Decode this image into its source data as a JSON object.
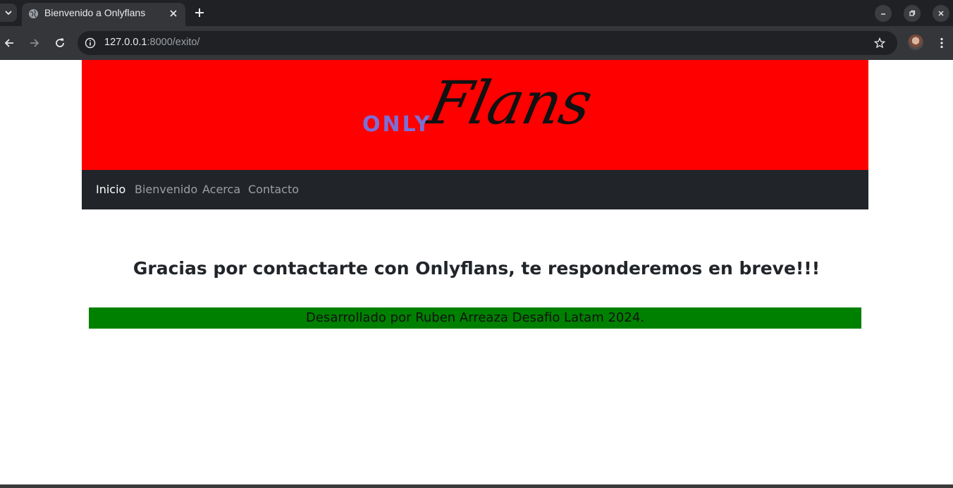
{
  "browser": {
    "tab_title": "Bienvenido a Onlyflans",
    "url_host": "127.0.0.1",
    "url_rest": ":8000/exito/"
  },
  "icons": {
    "tab_list": "chevron-down-icon",
    "favicon": "globe-icon",
    "tab_close": "close-icon",
    "new_tab": "plus-icon",
    "minimize": "minimize-icon",
    "restore": "restore-icon",
    "close_window": "close-icon",
    "back": "arrow-left-icon",
    "forward": "arrow-right-icon",
    "reload": "reload-icon",
    "site_info": "info-icon",
    "bookmark": "star-icon",
    "menu": "kebab-menu-icon"
  },
  "header": {
    "logo_only": "ONLY",
    "logo_flans": "Flans"
  },
  "nav": {
    "items": [
      {
        "label": "Inicio",
        "active": true
      },
      {
        "label": "Bienvenido",
        "active": false
      },
      {
        "label": "Acerca",
        "active": false
      },
      {
        "label": "Contacto",
        "active": false
      }
    ]
  },
  "main": {
    "message": "Gracias por contactarte con Onlyflans, te responderemos en breve!!!"
  },
  "footer": {
    "text": "Desarrollado por Ruben Arreaza Desafio Latam 2024."
  },
  "colors": {
    "header_bg": "#ff0000",
    "navbar_bg": "#212529",
    "footer_bg": "#008000",
    "logo_only": "#7b6fd6"
  }
}
